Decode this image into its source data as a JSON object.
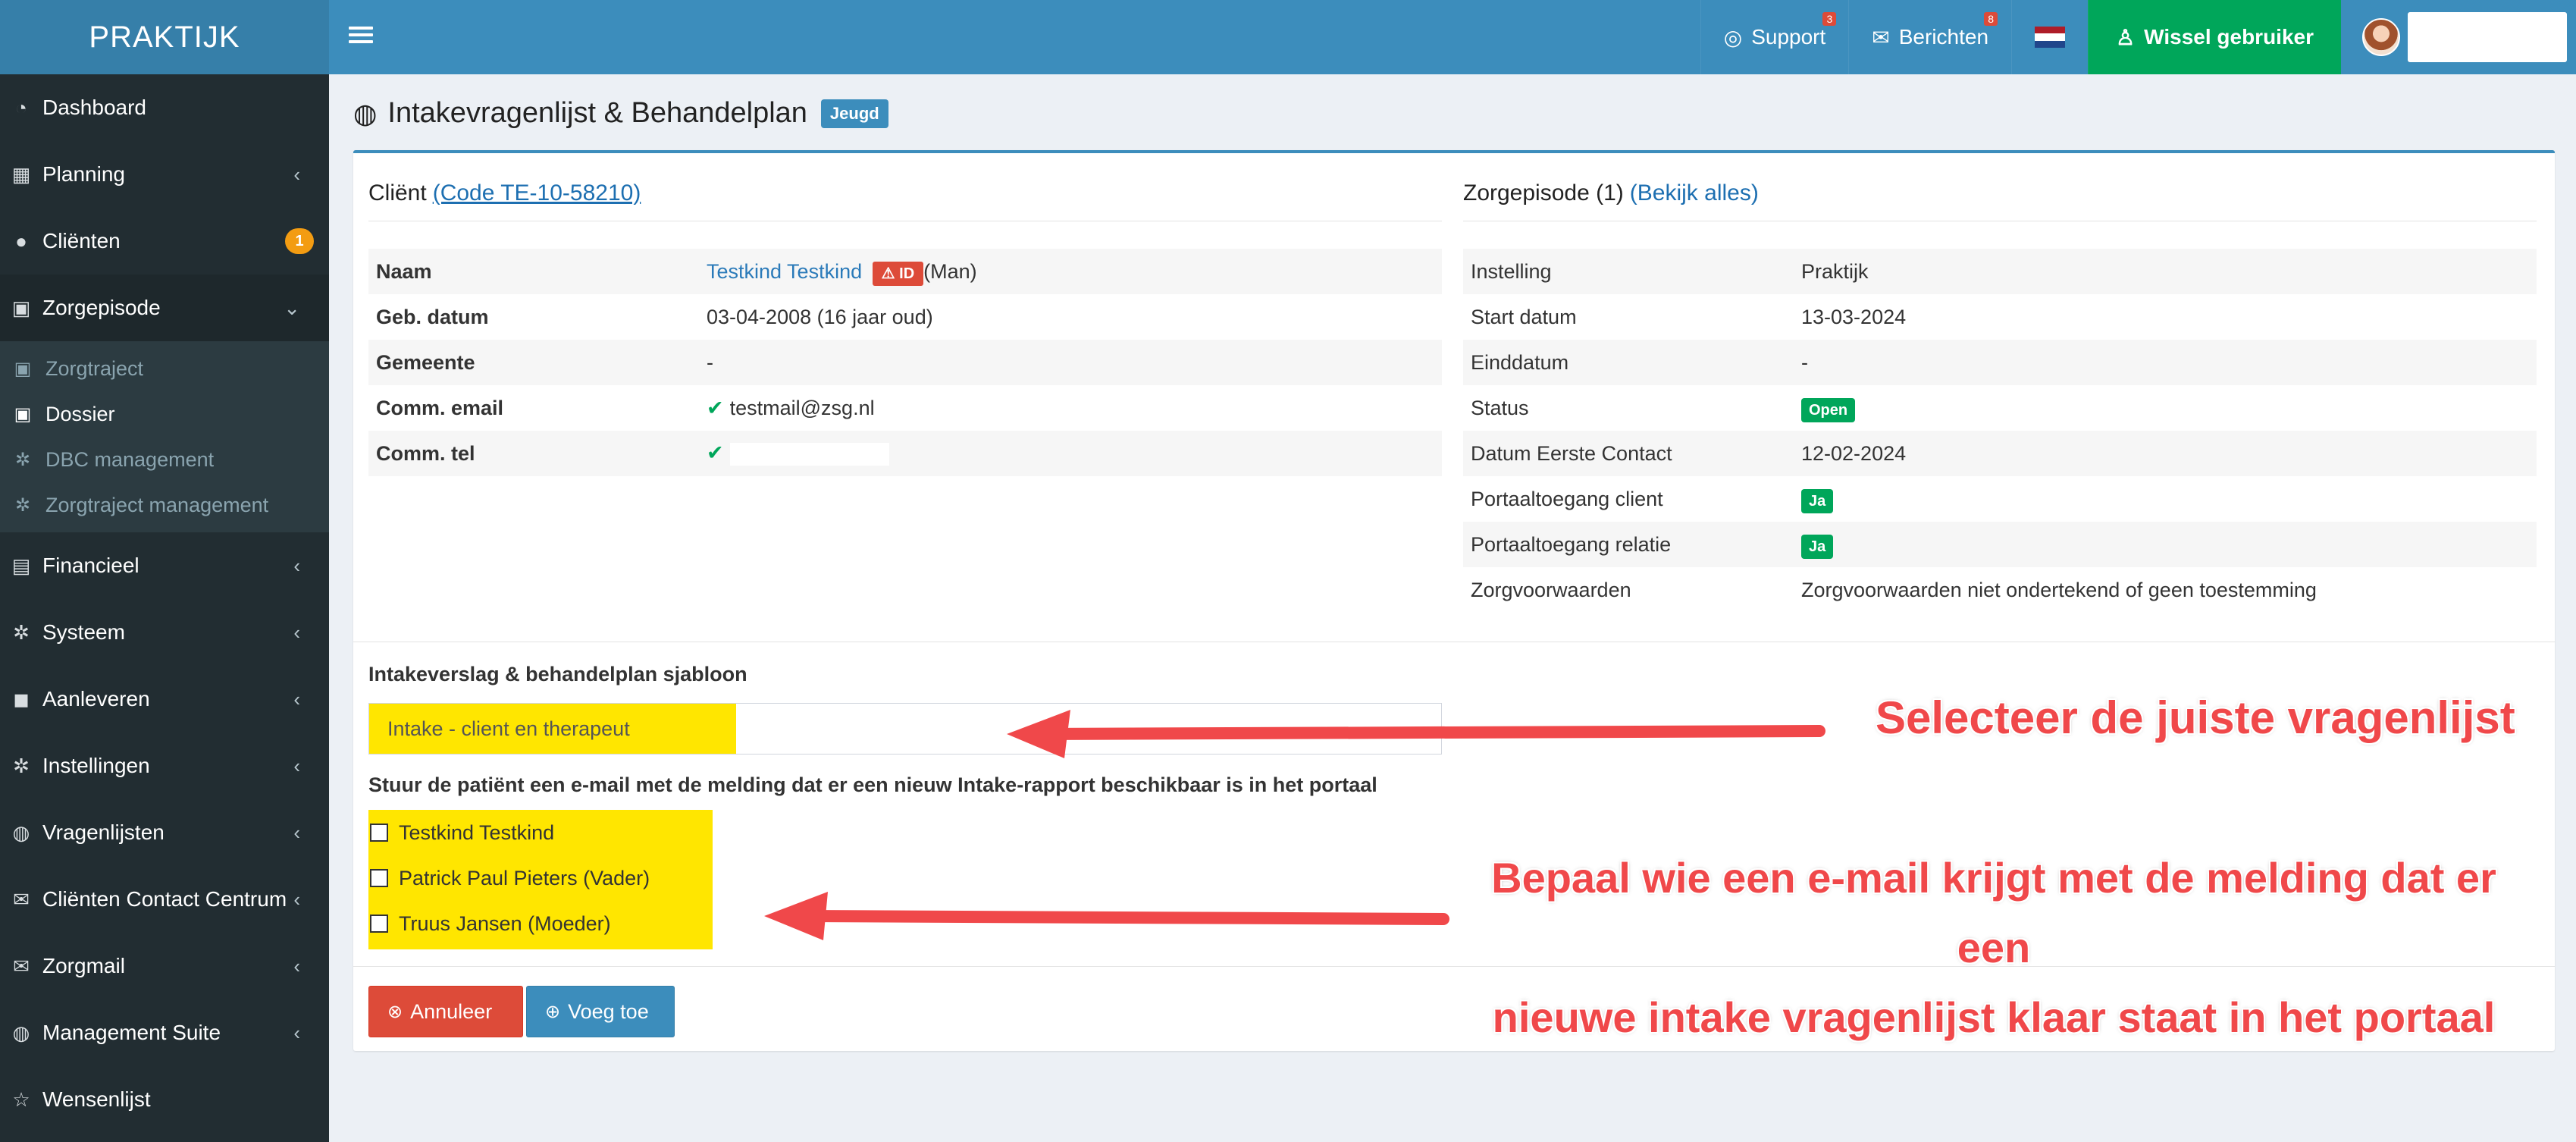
{
  "header": {
    "logo": "PRAKTIJK",
    "support_label": "Support",
    "support_badge": "3",
    "berichten_label": "Berichten",
    "berichten_badge": "8",
    "wissel_label": "Wissel gebruiker",
    "colors": {
      "topbar": "#3c8dbc",
      "wissel": "#00a65a"
    }
  },
  "sidebar": {
    "items": [
      {
        "label": "Dashboard",
        "icon": "dashboard-icon"
      },
      {
        "label": "Planning",
        "icon": "calendar-icon"
      },
      {
        "label": "Cliënten",
        "icon": "user-icon",
        "badge": "1"
      },
      {
        "label": "Zorgepisode",
        "icon": "medkit-icon"
      },
      {
        "label": "Financieel",
        "icon": "book-icon"
      },
      {
        "label": "Systeem",
        "icon": "cogs-icon"
      },
      {
        "label": "Aanleveren",
        "icon": "truck-icon"
      },
      {
        "label": "Instellingen",
        "icon": "gear-icon"
      },
      {
        "label": "Vragenlijsten",
        "icon": "globe-icon"
      },
      {
        "label": "Cliënten Contact Centrum",
        "icon": "envelope-icon"
      },
      {
        "label": "Zorgmail",
        "icon": "envelope-icon"
      },
      {
        "label": "Management Suite",
        "icon": "globe-icon"
      },
      {
        "label": "Wensenlijst",
        "icon": "star-icon"
      }
    ],
    "sub_items": [
      {
        "label": "Zorgtraject"
      },
      {
        "label": "Dossier"
      },
      {
        "label": "DBC management"
      },
      {
        "label": "Zorgtraject management"
      }
    ]
  },
  "page": {
    "title": "Intakevragenlijst & Behandelplan",
    "badge": "Jeugd"
  },
  "client": {
    "heading": "Cliënt",
    "code_link": "(Code TE-10-58210)",
    "rows": {
      "naam_label": "Naam",
      "naam_value": "Testkind Testkind",
      "id_label": "ID",
      "gender": "(Man)",
      "geb_label": "Geb. datum",
      "geb_value": "03-04-2008 (16 jaar oud)",
      "gemeente_label": "Gemeente",
      "gemeente_value": "-",
      "email_label": "Comm. email",
      "email_value": "testmail@zsg.nl",
      "tel_label": "Comm. tel"
    }
  },
  "episode": {
    "heading": "Zorgepisode (1)",
    "view_all": "(Bekijk alles)",
    "rows": [
      {
        "label": "Instelling",
        "value": "Praktijk"
      },
      {
        "label": "Start datum",
        "value": "13-03-2024"
      },
      {
        "label": "Einddatum",
        "value": "-"
      },
      {
        "label": "Status",
        "value": "Open",
        "tag": true
      },
      {
        "label": "Datum Eerste Contact",
        "value": "12-02-2024"
      },
      {
        "label": "Portaaltoegang client",
        "value": "Ja",
        "tag": true
      },
      {
        "label": "Portaaltoegang relatie",
        "value": "Ja",
        "tag": true
      },
      {
        "label": "Zorgvoorwaarden",
        "value": "Zorgvoorwaarden niet ondertekend of geen toestemming"
      }
    ]
  },
  "form": {
    "template_label": "Intakeverslag & behandelplan sjabloon",
    "template_value": "Intake - client en therapeut",
    "mail_label": "Stuur de patiënt een e-mail met de melding dat er een nieuw Intake-rapport beschikbaar is in het portaal",
    "recipients": [
      {
        "label": "Testkind Testkind"
      },
      {
        "label": "Patrick Paul Pieters (Vader)"
      },
      {
        "label": "Truus Jansen (Moeder)"
      }
    ],
    "cancel_label": "Annuleer",
    "add_label": "Voeg toe"
  },
  "annotations": {
    "select_hint": "Selecteer de juiste vragenlijst",
    "mail_hint_line1": "Bepaal wie een e-mail krijgt met de melding dat er een",
    "mail_hint_line2": "nieuwe intake vragenlijst klaar staat in het portaal",
    "color": "#f0484a"
  }
}
